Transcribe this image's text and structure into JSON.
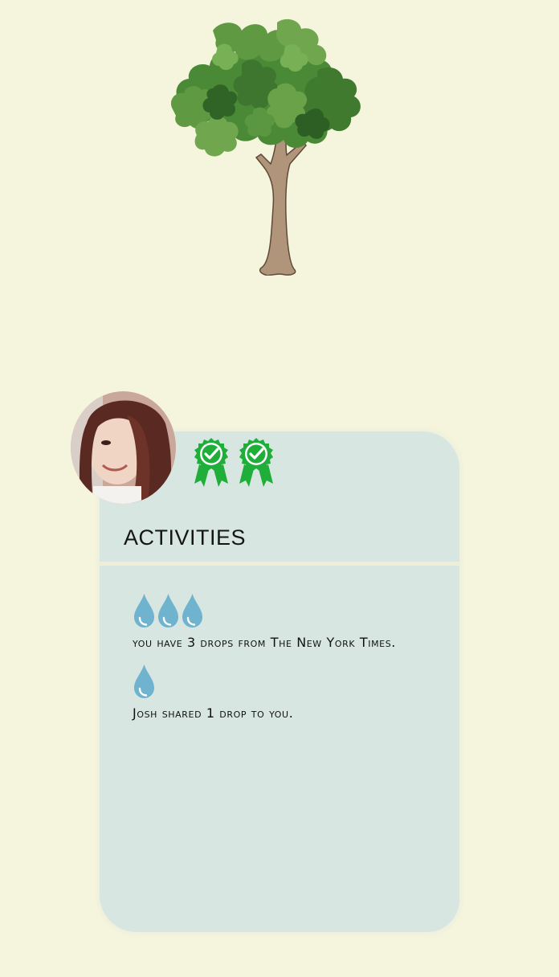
{
  "tree": {
    "icon": "tree-icon"
  },
  "profile": {
    "avatar_icon": "avatar-photo",
    "badges": [
      {
        "icon": "award-ribbon-check-icon",
        "color": "#1fae3a"
      },
      {
        "icon": "award-ribbon-check-icon",
        "color": "#1fae3a"
      }
    ]
  },
  "activities": {
    "title": "ACTIVITIES",
    "items": [
      {
        "drop_count": 3,
        "text": "you have 3 drops from The New York Times."
      },
      {
        "drop_count": 1,
        "text": "Josh shared 1 drop to you."
      }
    ]
  },
  "colors": {
    "background": "#f5f4dc",
    "card": "#d8e6e1",
    "drop": "#6fb3cf",
    "badge": "#1fae3a"
  }
}
